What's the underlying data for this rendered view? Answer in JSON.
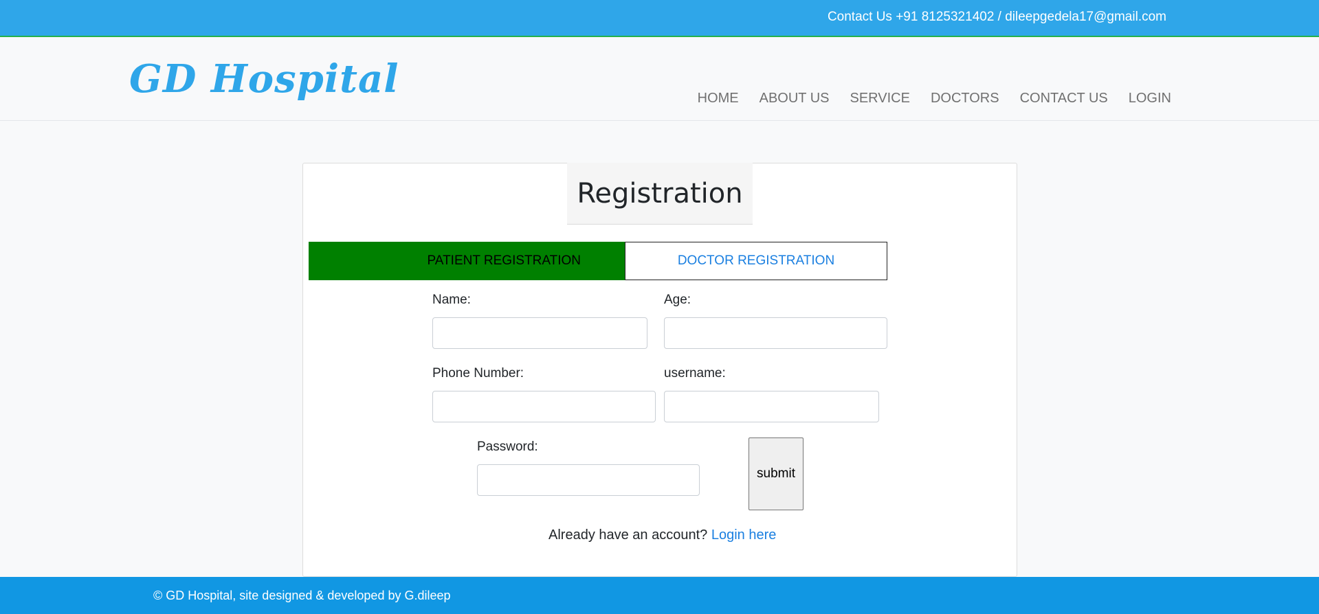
{
  "topbar": {
    "contact": "Contact Us +91 8125321402 / dileepgedela17@gmail.com"
  },
  "header": {
    "logo": "GD Hospital",
    "nav": [
      "HOME",
      "ABOUT US",
      "SERVICE",
      "DOCTORS",
      "CONTACT US",
      "LOGIN"
    ]
  },
  "form": {
    "title": "Registration",
    "tabs": {
      "patient": "PATIENT REGISTRATION",
      "doctor": "DOCTOR REGISTRATION"
    },
    "fields": {
      "name": {
        "label": "Name:",
        "value": ""
      },
      "age": {
        "label": "Age:",
        "value": ""
      },
      "phone": {
        "label": "Phone Number:",
        "value": ""
      },
      "username": {
        "label": "username:",
        "value": ""
      },
      "password": {
        "label": "Password:",
        "value": ""
      }
    },
    "submit": "submit",
    "account_text": "Already have an account?",
    "login_link": "Login here"
  },
  "footer": {
    "copyright": "© GD Hospital, site designed & developed by G.dileep"
  },
  "colors": {
    "topbar": "#2fa6e9",
    "footer": "#1197e3",
    "active_tab": "#008000",
    "link": "#1a7fe0"
  }
}
